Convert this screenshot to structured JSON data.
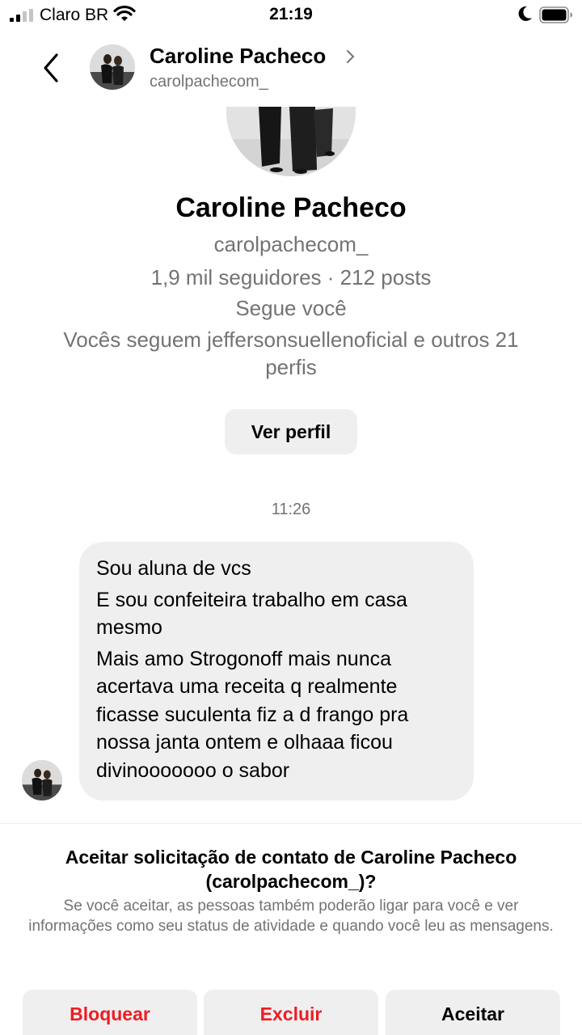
{
  "status_bar": {
    "carrier": "Claro BR",
    "time": "21:19"
  },
  "header": {
    "name": "Caroline Pacheco",
    "username": "carolpachecom_"
  },
  "profile": {
    "name": "Caroline Pacheco",
    "username": "carolpachecom_",
    "stats": "1,9 mil seguidores · 212 posts",
    "follows_you": "Segue você",
    "mutual": "Vocês seguem jeffersonsuellenoficial e outros 21 perfis",
    "view_profile_label": "Ver perfil"
  },
  "conversation": {
    "timestamp": "11:26",
    "message_lines": [
      "Sou aluna de vcs",
      "E sou confeiteira trabalho em casa mesmo",
      "Mais amo Strogonoff mais nunca acertava uma receita q realmente ficasse suculenta fiz a d frango pra nossa janta ontem e olhaaa ficou divinooooooo o sabor"
    ]
  },
  "request": {
    "title": "Aceitar solicitação de contato de Caroline Pacheco (carolpachecom_)?",
    "description": "Se você aceitar, as pessoas também poderão ligar para você e ver informações como seu status de atividade e quando você leu as mensagens.",
    "block_label": "Bloquear",
    "delete_label": "Excluir",
    "accept_label": "Aceitar"
  },
  "colors": {
    "danger": "#ed1c24",
    "muted_text": "#737373",
    "bubble_bg": "#efefef"
  }
}
